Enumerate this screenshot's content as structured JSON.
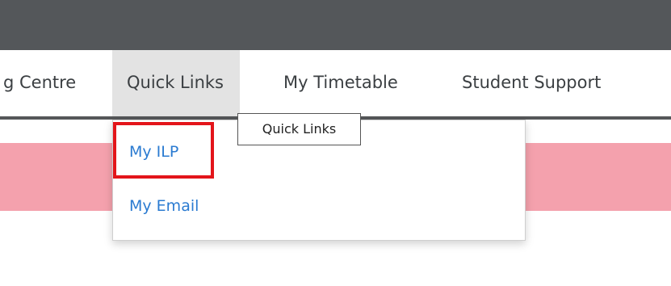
{
  "nav": {
    "items": [
      {
        "label": "g Centre"
      },
      {
        "label": "Quick Links"
      },
      {
        "label": "My Timetable"
      },
      {
        "label": "Student Support"
      }
    ]
  },
  "dropdown": {
    "items": [
      {
        "label": "My ILP"
      },
      {
        "label": "My Email"
      }
    ]
  },
  "tooltip": {
    "text": "Quick Links"
  },
  "colors": {
    "topbar": "#54575a",
    "banner": "#f4a1ad",
    "link": "#2b7bd1",
    "highlight": "#e3151a",
    "active_nav_bg": "#e3e3e3"
  }
}
